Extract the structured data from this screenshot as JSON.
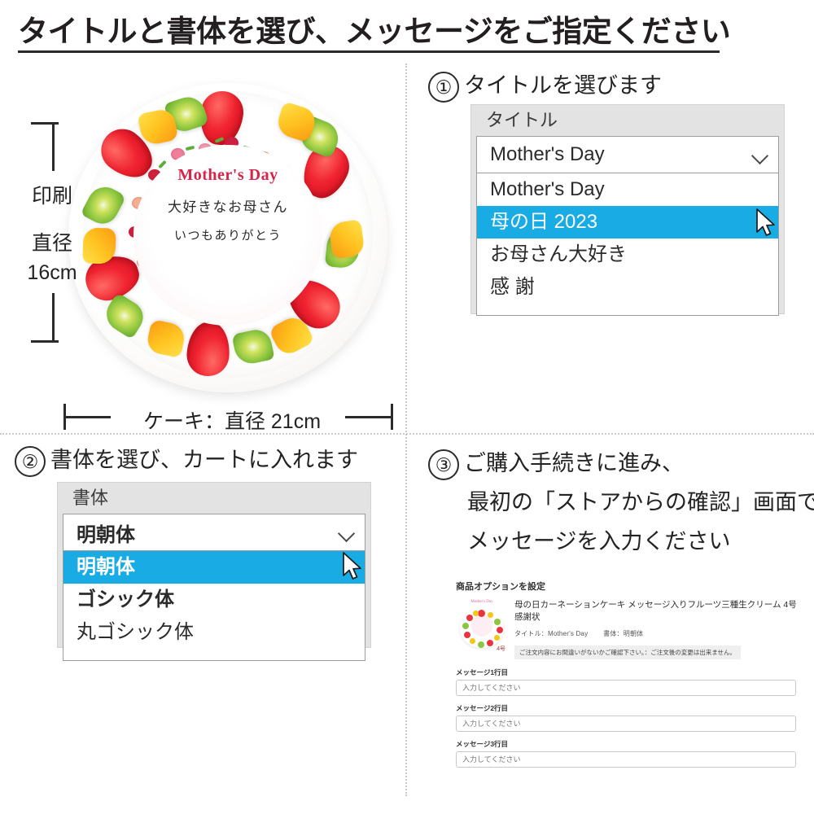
{
  "header": {
    "title": "タイトルと書体を選び、メッセージをご指定ください"
  },
  "cake": {
    "message_line1": "Mother's Day",
    "message_line2": "大好きなお母さん",
    "message_line3": "いつもありがとう",
    "print_dimension_line1": "印刷",
    "print_dimension_line2": "直径",
    "print_dimension_line3": "16cm",
    "cake_dimension": "ケーキ：直径 21cm"
  },
  "step1": {
    "number": "①",
    "heading": "タイトルを選びます",
    "dropdown": {
      "label": "タイトル",
      "selected_value": "Mother's Day",
      "chevron_icon": "chevron-down-icon",
      "options": [
        {
          "label": "Mother's Day",
          "selected": false
        },
        {
          "label": "母の日 2023",
          "selected": true
        },
        {
          "label": "お母さん大好き",
          "selected": false
        },
        {
          "label": "感 謝",
          "selected": false
        }
      ]
    }
  },
  "step2": {
    "number": "②",
    "heading": "書体を選び、カートに入れます",
    "dropdown": {
      "label": "書体",
      "selected_value": "明朝体",
      "chevron_icon": "chevron-down-icon",
      "options": [
        {
          "label": "明朝体",
          "selected": true,
          "style": "mincho"
        },
        {
          "label": "ゴシック体",
          "selected": false,
          "style": "gothic"
        },
        {
          "label": "丸ゴシック体",
          "selected": false,
          "style": "maru"
        }
      ]
    }
  },
  "step3": {
    "number": "③",
    "heading_line1": "ご購入手続きに進み、",
    "heading_line2": "最初の「ストアからの確認」画面で、",
    "heading_line3": "メッセージを入力ください",
    "store_panel": {
      "heading": "商品オプションを設定",
      "thumbnail_watermark": "Mother's Day",
      "thumbnail_size_label": "4号",
      "product_name": "母の日カーネーションケーキ メッセージ入りフルーツ三種生クリーム 4号 感謝状",
      "spec_title": "タイトル：Mother's  Day",
      "spec_font": "書体：明朝体",
      "note": "ご注文内容にお間違いがないかご確認下さい。：ご注文後の変更は出来ません。",
      "fields": [
        {
          "label": "メッセージ1行目",
          "placeholder": "入力してください",
          "value": ""
        },
        {
          "label": "メッセージ2行目",
          "placeholder": "入力してください",
          "value": ""
        },
        {
          "label": "メッセージ3行目",
          "placeholder": "入力してください",
          "value": ""
        }
      ]
    }
  },
  "colors": {
    "highlight": "#18ABE4",
    "panel_gray": "#e3e3e3",
    "text": "#232323",
    "cake_title_red": "#d6244b"
  }
}
